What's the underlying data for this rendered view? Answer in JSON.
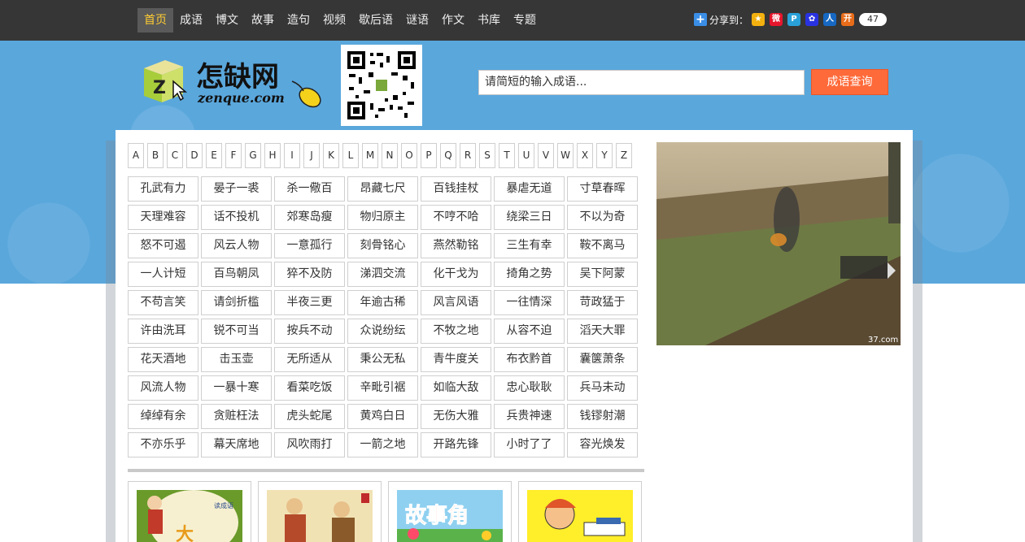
{
  "nav": {
    "items": [
      "首页",
      "成语",
      "博文",
      "故事",
      "造句",
      "视频",
      "歇后语",
      "谜语",
      "作文",
      "书库",
      "专题"
    ],
    "active_index": 0
  },
  "share": {
    "label": "分享到：",
    "count": "47",
    "icons": [
      "qzone-icon",
      "weibo-icon",
      "pengyou-icon",
      "baidu-icon",
      "renren-icon",
      "kaixin-icon"
    ]
  },
  "logo": {
    "site_name": "怎缺网",
    "domain": "zenque.com"
  },
  "search": {
    "value": "请简短的输入成语...",
    "button_label": "成语查询"
  },
  "letters": [
    "A",
    "B",
    "C",
    "D",
    "E",
    "F",
    "G",
    "H",
    "I",
    "J",
    "K",
    "L",
    "M",
    "N",
    "O",
    "P",
    "Q",
    "R",
    "S",
    "T",
    "U",
    "V",
    "W",
    "X",
    "Y",
    "Z"
  ],
  "idioms": [
    "孔武有力",
    "晏子一裘",
    "杀一儆百",
    "昂藏七尺",
    "百钱挂杖",
    "暴虐无道",
    "寸草春晖",
    "天理难容",
    "话不投机",
    "郊寒岛瘦",
    "物归原主",
    "不哼不哈",
    "绕梁三日",
    "不以为奇",
    "怒不可遏",
    "风云人物",
    "一意孤行",
    "刻骨铭心",
    "燕然勒铭",
    "三生有幸",
    "鞍不离马",
    "一人计短",
    "百鸟朝凤",
    "猝不及防",
    "涕泗交流",
    "化干戈为",
    "掎角之势",
    "吴下阿蒙",
    "不苟言笑",
    "请剑折槛",
    "半夜三更",
    "年逾古稀",
    "风言风语",
    "一往情深",
    "苛政猛于",
    "许由洗耳",
    "锐不可当",
    "按兵不动",
    "众说纷纭",
    "不牧之地",
    "从容不迫",
    "滔天大罪",
    "花天酒地",
    "击玉壶",
    "无所适从",
    "秉公无私",
    "青牛度关",
    "布衣黔首",
    "囊箧萧条",
    "风流人物",
    "一暴十寒",
    "看菜吃饭",
    "辛毗引裾",
    "如临大敌",
    "忠心耿耿",
    "兵马未动",
    "绰绰有余",
    "贪赃枉法",
    "虎头蛇尾",
    "黄鸡白日",
    "无伤大雅",
    "兵贵神速",
    "钱镠射潮",
    "不亦乐乎",
    "幕天席地",
    "风吹雨打",
    "一箭之地",
    "开路先锋",
    "小时了了",
    "容光焕发"
  ],
  "video": {
    "watermark": "37.com"
  },
  "cards": [
    {
      "caption": ""
    },
    {
      "caption": ""
    },
    {
      "caption": "故事角"
    },
    {
      "caption": ""
    }
  ],
  "colors": {
    "topbar": "#363636",
    "band": "#5aa7dc",
    "accent": "#ff6a3a",
    "nav_active": "#ffcc33"
  }
}
